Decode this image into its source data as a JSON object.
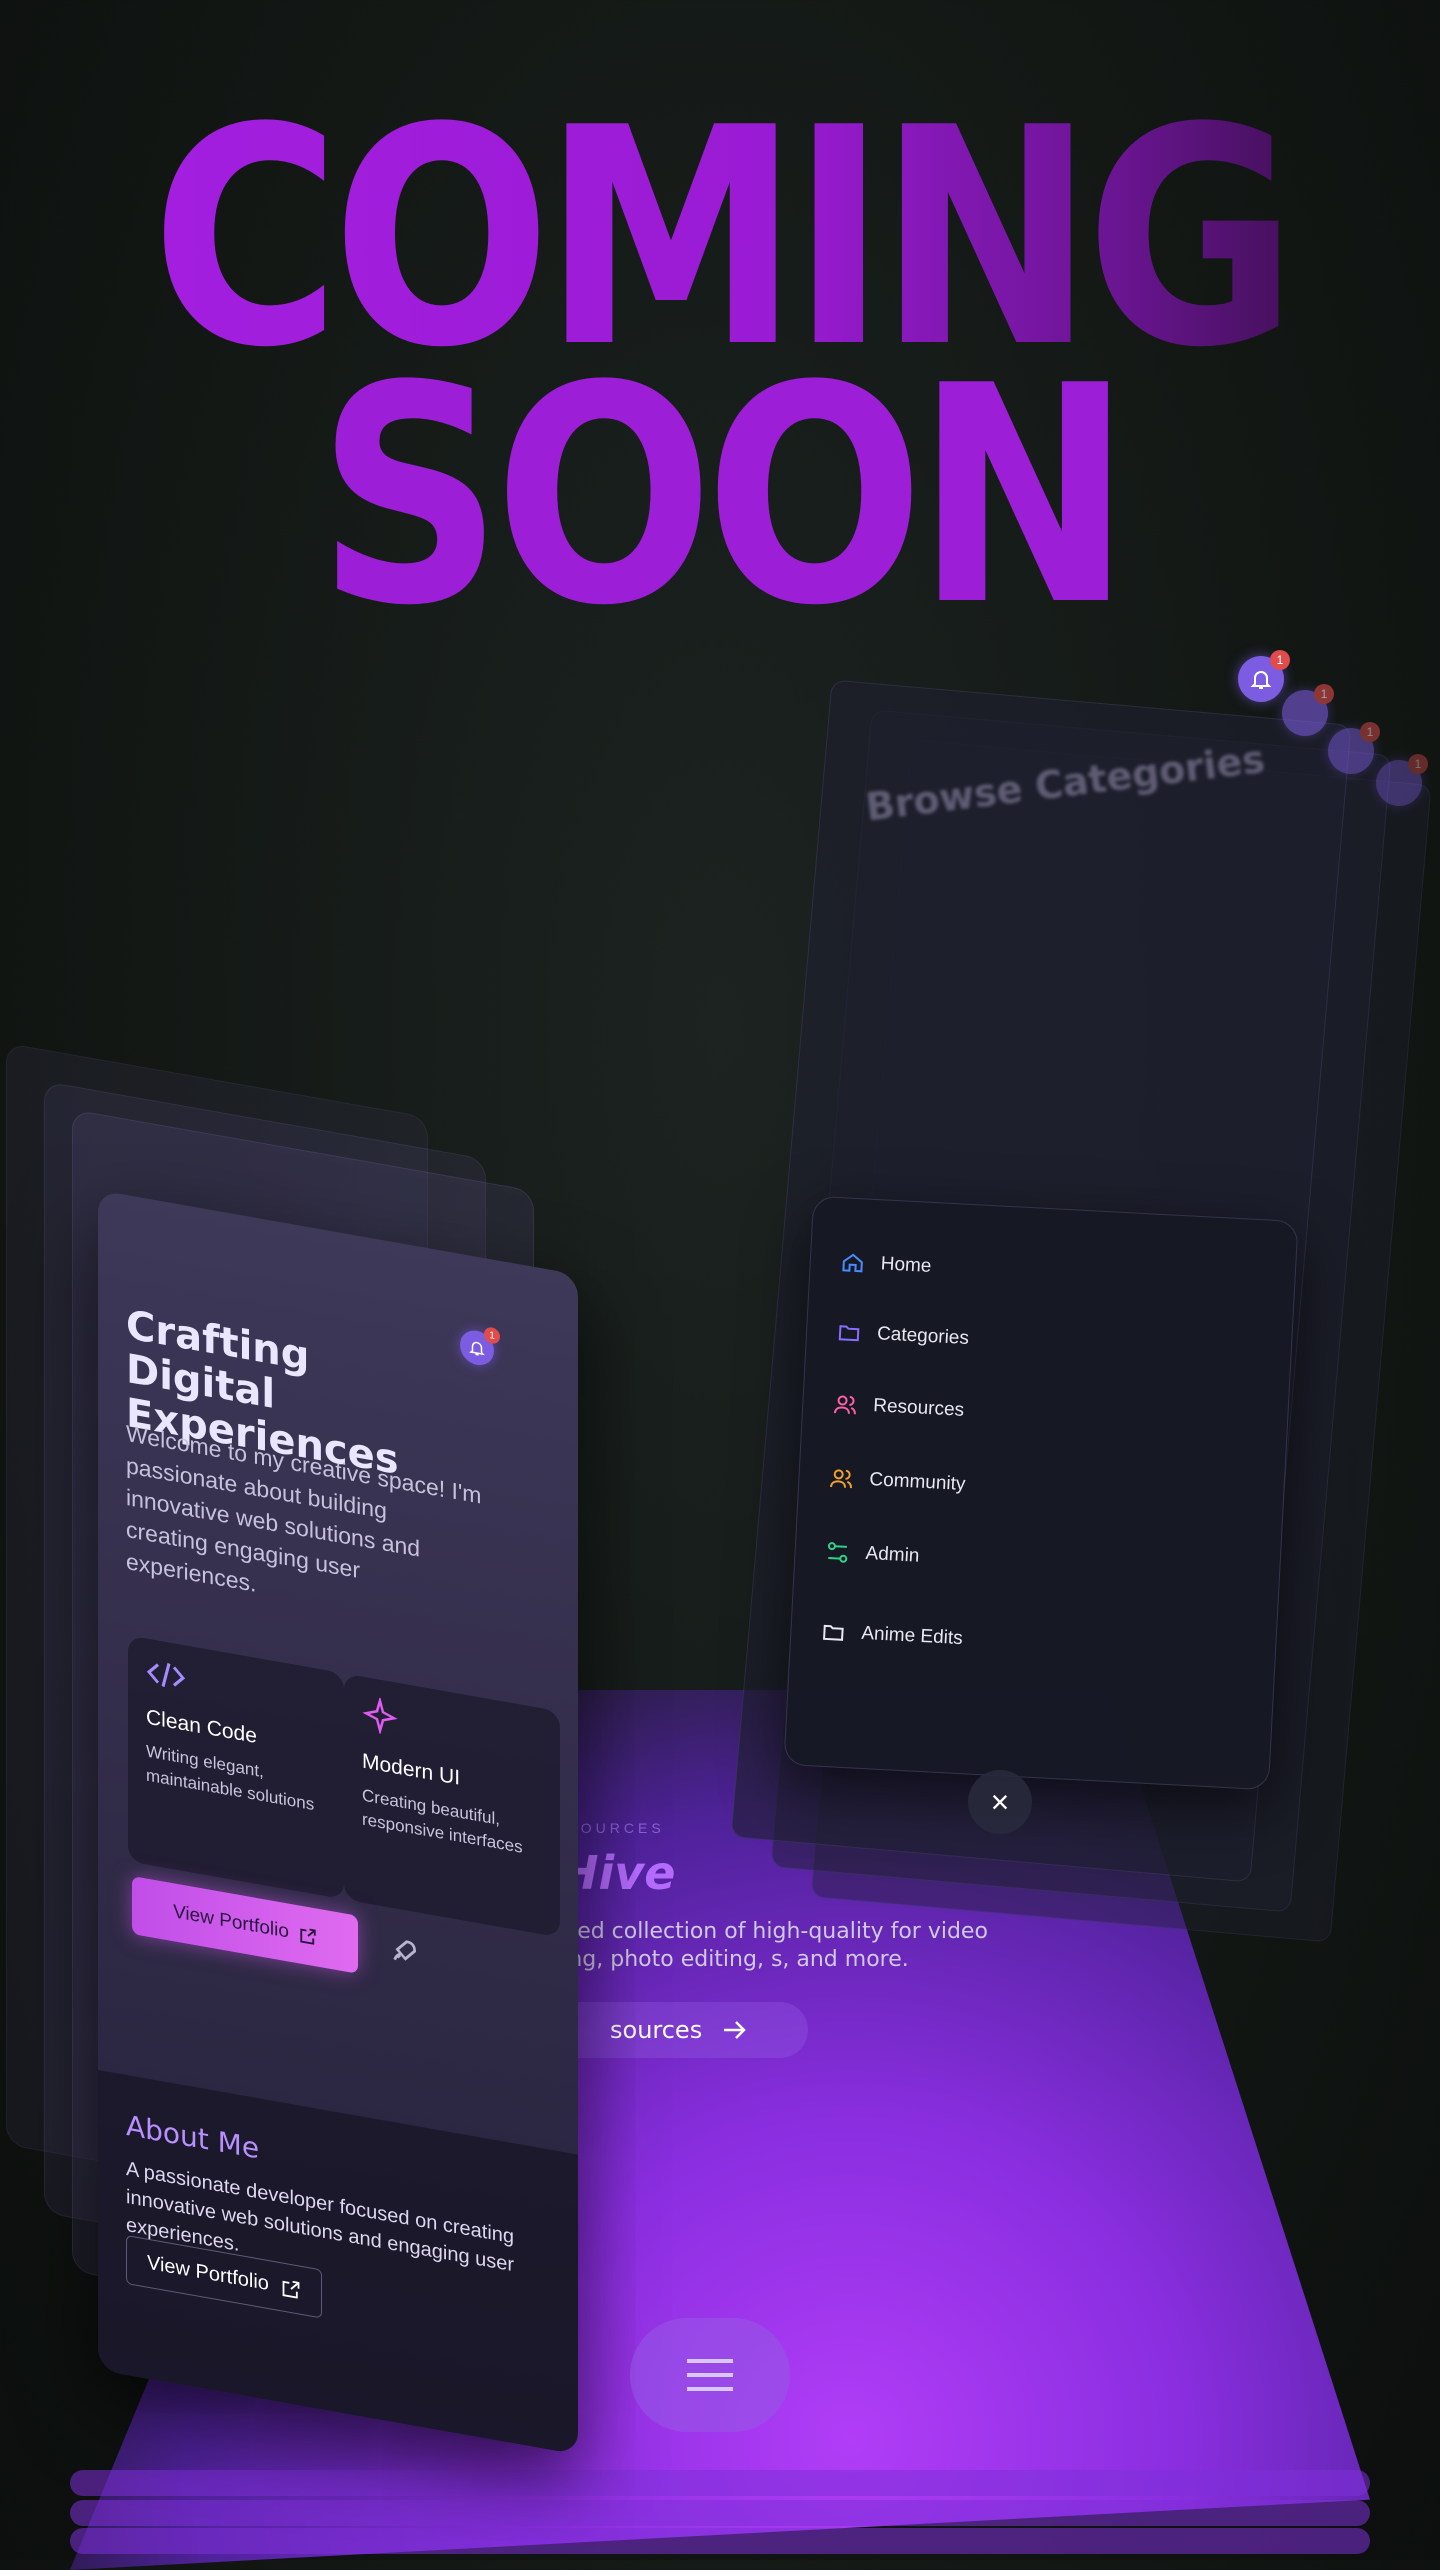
{
  "hero": {
    "line1": "COMING",
    "line2": "SOON"
  },
  "colors": {
    "accent": "#9d1fd6",
    "stage": "#a43af2",
    "notification": "#e04c4c",
    "home_icon": "#4a8cff",
    "categories_icon": "#8a6cff",
    "resources_icon": "#ff5fa8",
    "community_icon": "#f0a030",
    "admin_icon": "#2fd28a"
  },
  "browse_panel": {
    "title": "Browse Categories",
    "notification_count": "1"
  },
  "nav_menu": {
    "items": [
      {
        "label": "Home",
        "icon": "home-icon"
      },
      {
        "label": "Categories",
        "icon": "folder-icon"
      },
      {
        "label": "Resources",
        "icon": "users-icon"
      },
      {
        "label": "Community",
        "icon": "users-icon"
      },
      {
        "label": "Admin",
        "icon": "sliders-icon"
      },
      {
        "label": "Anime Edits",
        "icon": "folder-icon"
      }
    ],
    "close_label": "×"
  },
  "resources": {
    "eyebrow": "RESOURCES",
    "title": "Hive",
    "description": "curated collection of high-quality for video editing, photo editing, s, and more.",
    "button_label": "sources"
  },
  "portfolio_card": {
    "notification_count": "1",
    "title": "Crafting Digital Experiences",
    "intro": "Welcome to my creative space! I'm passionate about building innovative web solutions and creating engaging user experiences.",
    "features": [
      {
        "title": "Clean Code",
        "desc": "Writing elegant, maintainable solutions",
        "icon": "code-icon"
      },
      {
        "title": "Modern UI",
        "desc": "Creating beautiful, responsive interfaces",
        "icon": "sparkle-icon"
      }
    ],
    "view_portfolio_label": "View Portfolio",
    "about": {
      "heading": "About Me",
      "text": "A passionate developer focused on creating innovative web solutions and engaging user experiences.",
      "button_label": "View Portfolio"
    }
  },
  "menu_button_icon": "hamburger-icon"
}
